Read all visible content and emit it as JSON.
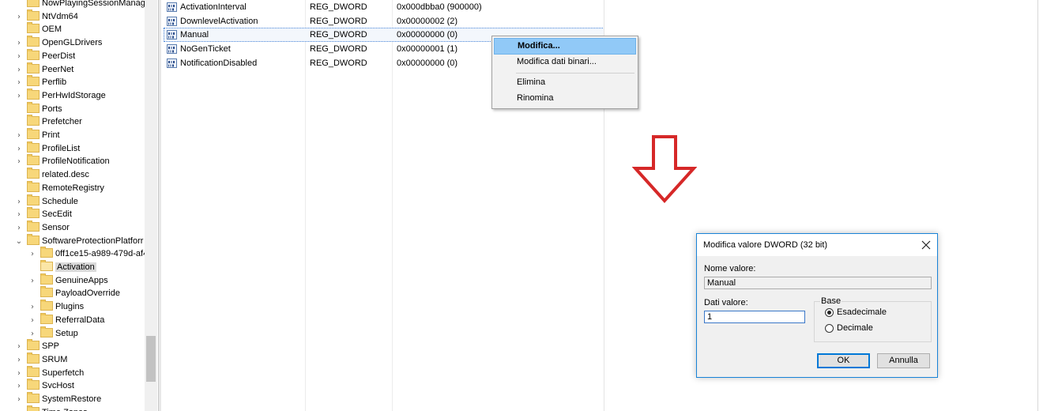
{
  "tree": {
    "items": [
      {
        "label": "NowPlayingSessionManag",
        "arrow": "",
        "indent": 0
      },
      {
        "label": "NtVdm64",
        "arrow": "›",
        "indent": 0
      },
      {
        "label": "OEM",
        "arrow": "",
        "indent": 0
      },
      {
        "label": "OpenGLDrivers",
        "arrow": "›",
        "indent": 0
      },
      {
        "label": "PeerDist",
        "arrow": "›",
        "indent": 0
      },
      {
        "label": "PeerNet",
        "arrow": "›",
        "indent": 0
      },
      {
        "label": "Perflib",
        "arrow": "›",
        "indent": 0
      },
      {
        "label": "PerHwIdStorage",
        "arrow": "›",
        "indent": 0
      },
      {
        "label": "Ports",
        "arrow": "",
        "indent": 0
      },
      {
        "label": "Prefetcher",
        "arrow": "",
        "indent": 0
      },
      {
        "label": "Print",
        "arrow": "›",
        "indent": 0
      },
      {
        "label": "ProfileList",
        "arrow": "›",
        "indent": 0
      },
      {
        "label": "ProfileNotification",
        "arrow": "›",
        "indent": 0
      },
      {
        "label": "related.desc",
        "arrow": "",
        "indent": 0
      },
      {
        "label": "RemoteRegistry",
        "arrow": "",
        "indent": 0
      },
      {
        "label": "Schedule",
        "arrow": "›",
        "indent": 0
      },
      {
        "label": "SecEdit",
        "arrow": "›",
        "indent": 0
      },
      {
        "label": "Sensor",
        "arrow": "›",
        "indent": 0
      },
      {
        "label": "SoftwareProtectionPlatforr",
        "arrow": "⌄",
        "indent": 0
      },
      {
        "label": "0ff1ce15-a989-479d-af4",
        "arrow": "›",
        "indent": 1
      },
      {
        "label": "Activation",
        "arrow": "",
        "indent": 1,
        "selected": true
      },
      {
        "label": "GenuineApps",
        "arrow": "›",
        "indent": 1
      },
      {
        "label": "PayloadOverride",
        "arrow": "",
        "indent": 1
      },
      {
        "label": "Plugins",
        "arrow": "›",
        "indent": 1
      },
      {
        "label": "ReferralData",
        "arrow": "›",
        "indent": 1
      },
      {
        "label": "Setup",
        "arrow": "›",
        "indent": 1
      },
      {
        "label": "SPP",
        "arrow": "›",
        "indent": 0
      },
      {
        "label": "SRUM",
        "arrow": "›",
        "indent": 0
      },
      {
        "label": "Superfetch",
        "arrow": "›",
        "indent": 0
      },
      {
        "label": "SvcHost",
        "arrow": "›",
        "indent": 0
      },
      {
        "label": "SystemRestore",
        "arrow": "›",
        "indent": 0
      },
      {
        "label": "Time Zones",
        "arrow": "›",
        "indent": 0
      }
    ]
  },
  "values": {
    "icon_text": "010\n110",
    "rows": [
      {
        "name": "ActivationInterval",
        "type": "REG_DWORD",
        "data": "0x000dbba0 (900000)"
      },
      {
        "name": "DownlevelActivation",
        "type": "REG_DWORD",
        "data": "0x00000002 (2)"
      },
      {
        "name": "Manual",
        "type": "REG_DWORD",
        "data": "0x00000000 (0)",
        "focused": true
      },
      {
        "name": "NoGenTicket",
        "type": "REG_DWORD",
        "data": "0x00000001 (1)"
      },
      {
        "name": "NotificationDisabled",
        "type": "REG_DWORD",
        "data": "0x00000000 (0)"
      }
    ]
  },
  "context_menu": {
    "items": [
      {
        "label": "Modifica...",
        "highlighted": true,
        "bold": true
      },
      {
        "label": "Modifica dati binari..."
      },
      {
        "label": "Elimina"
      },
      {
        "label": "Rinomina"
      }
    ]
  },
  "arrow": {
    "color": "#d62828"
  },
  "dialog": {
    "title": "Modifica valore DWORD (32 bit)",
    "name_label": "Nome valore:",
    "name_value": "Manual",
    "data_label": "Dati valore:",
    "data_value": "1",
    "base_label": "Base",
    "radio_hex": "Esadecimale",
    "radio_dec": "Decimale",
    "selected_base": "Esadecimale",
    "ok_label": "OK",
    "cancel_label": "Annulla"
  }
}
